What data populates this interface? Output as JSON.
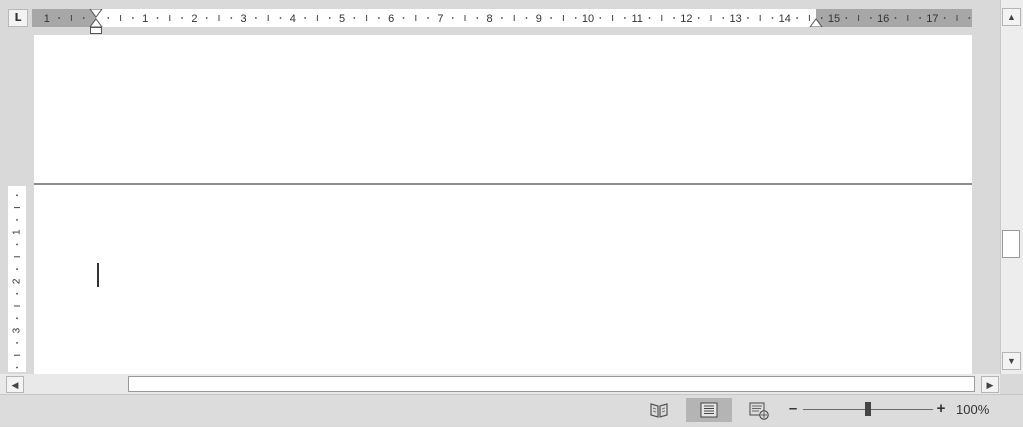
{
  "window": {
    "title": ""
  },
  "rulers": {
    "tab_selector_glyph": "L",
    "horizontal_ticks": [
      "1",
      "1",
      "2",
      "3",
      "4",
      "5",
      "6",
      "7",
      "8",
      "9",
      "10",
      "11",
      "12",
      "13",
      "14",
      "15",
      "16",
      "17"
    ],
    "vertical_ticks": [
      "1",
      "2",
      "3"
    ]
  },
  "scrollbars": {
    "up_arrow": "▲",
    "down_arrow": "▼",
    "left_arrow": "◀",
    "right_arrow": "▶"
  },
  "status_bar": {
    "views": [
      {
        "name": "read-mode",
        "icon": "open-book-icon"
      },
      {
        "name": "print-layout",
        "icon": "page-lines-icon",
        "active": true
      },
      {
        "name": "web-layout",
        "icon": "web-page-icon"
      }
    ],
    "zoom_out_label": "–",
    "zoom_in_label": "+",
    "zoom_level": "100%",
    "zoom_fraction": 0.5
  },
  "colors": {
    "ruler_margin": "#a7a7a7",
    "ruler_active": "#ffffff",
    "page": "#ffffff",
    "chrome": "#d9d9d9"
  }
}
